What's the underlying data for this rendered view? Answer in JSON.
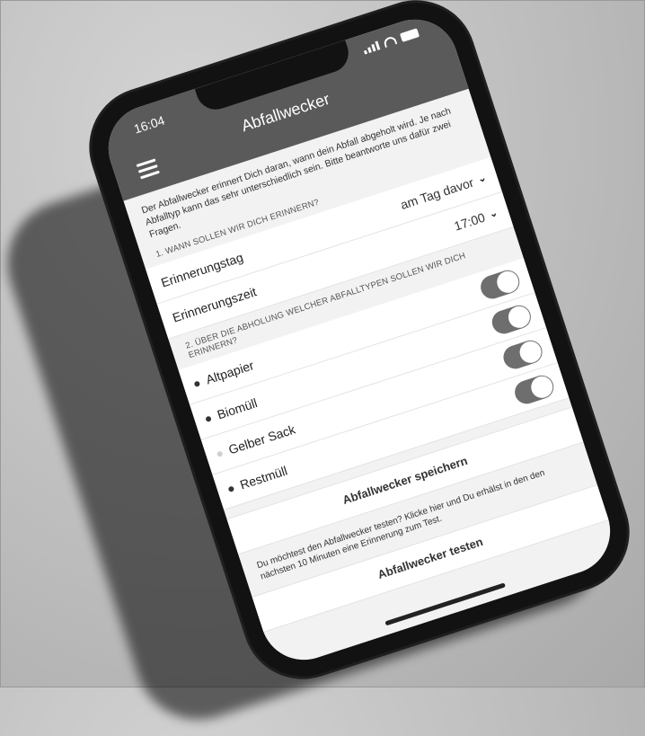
{
  "status": {
    "time": "16:04"
  },
  "header": {
    "title": "Abfallwecker"
  },
  "intro": "Der Abfallwecker erinnert Dich daran, wann dein Abfall abgeholt wird. Je nach Abfalltyp kann das sehr unterschiedlich sein. Bitte beantworte uns dafür zwei Fragen.",
  "section1": {
    "heading": "1. WANN SOLLEN WIR DICH ERINNERN?",
    "rows": [
      {
        "label": "Erinnerungstag",
        "value": "am Tag davor"
      },
      {
        "label": "Erinnerungszeit",
        "value": "17:00"
      }
    ]
  },
  "section2": {
    "heading": "2. ÜBER DIE ABHOLUNG WELCHER ABFALLTYPEN SOLLEN WIR DICH ERINNERN?",
    "items": [
      {
        "label": "Altpapier",
        "on": true
      },
      {
        "label": "Biomüll",
        "on": true
      },
      {
        "label": "Gelber Sack",
        "on": true
      },
      {
        "label": "Restmüll",
        "on": true
      }
    ]
  },
  "save_button": "Abfallwecker speichern",
  "test_note": "Du möchtest den Abfallwecker testen? Klicke hier und Du erhälst in den den nächsten 10 Minuten eine Erinnerung zum Test.",
  "test_button": "Abfallwecker testen"
}
